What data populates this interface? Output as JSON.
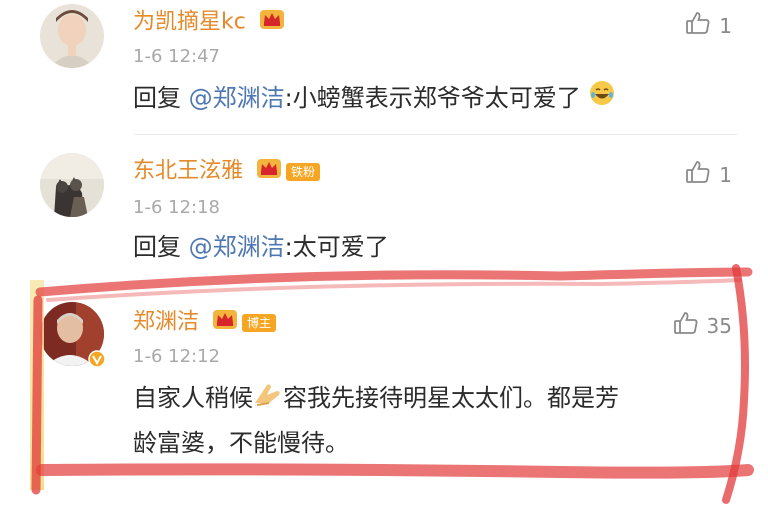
{
  "comments": [
    {
      "name": "为凯摘星kc",
      "time": "1-6 12:47",
      "reply_prefix": "回复",
      "mention": "@郑渊洁",
      "text_after_mention": ":小螃蟹表示郑爷爷太可爱了",
      "likes": "1",
      "badge": ""
    },
    {
      "name": "东北王泫雅",
      "time": "1-6 12:18",
      "reply_prefix": "回复",
      "mention": "@郑渊洁",
      "text_after_mention": ":太可爱了",
      "likes": "1",
      "badge": "铁粉"
    },
    {
      "name": "郑渊洁",
      "time": "1-6 12:12",
      "text_line1_a": "自家人稍候",
      "text_line1_b": "容我先接待明星太太们。都是芳",
      "text_line2": "龄富婆，不能慢待。",
      "likes": "35",
      "badge": "博主"
    }
  ],
  "colors": {
    "username": "#e58a2a",
    "mention": "#4f78b3",
    "annotation_red": "#e23a3a"
  }
}
